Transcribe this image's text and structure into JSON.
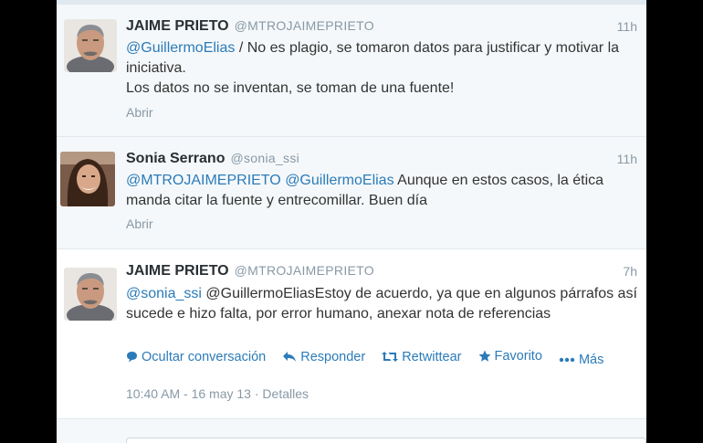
{
  "tweets": [
    {
      "name": "JAIME PRIETO",
      "handle": "@MTROJAIMEPRIETO",
      "time": "11h",
      "mention": "@GuillermoElias",
      "text_after": " / No es plagio, se tomaron datos para justificar y motivar la iniciativa.",
      "text_line2": "Los datos no se inventan, se toman de una fuente!",
      "open": "Abrir"
    },
    {
      "name": "Sonia Serrano",
      "handle": "@sonia_ssi",
      "time": "11h",
      "mention1": "@MTROJAIMEPRIETO",
      "mention2": "@GuillermoElias",
      "text_after": " Aunque en estos casos, la ética manda citar la fuente y entrecomillar. Buen día",
      "open": "Abrir"
    },
    {
      "name": "JAIME PRIETO",
      "handle": "@MTROJAIMEPRIETO",
      "time": "7h",
      "mention": "@sonia_ssi",
      "text_after": " @GuillermoEliasEstoy de acuerdo, ya que en algunos párrafos así sucede e hizo falta, por error humano, anexar nota de referencias",
      "actions": {
        "hide": "Ocultar conversación",
        "reply": "Responder",
        "retweet": "Retwittear",
        "favorite": "Favorito",
        "more": "Más"
      },
      "timestamp": "10:40 AM - 16 may 13",
      "details": "Detalles"
    }
  ],
  "colors": {
    "link": "#2b7bb9",
    "muted": "#8899a6",
    "text": "#333333"
  }
}
